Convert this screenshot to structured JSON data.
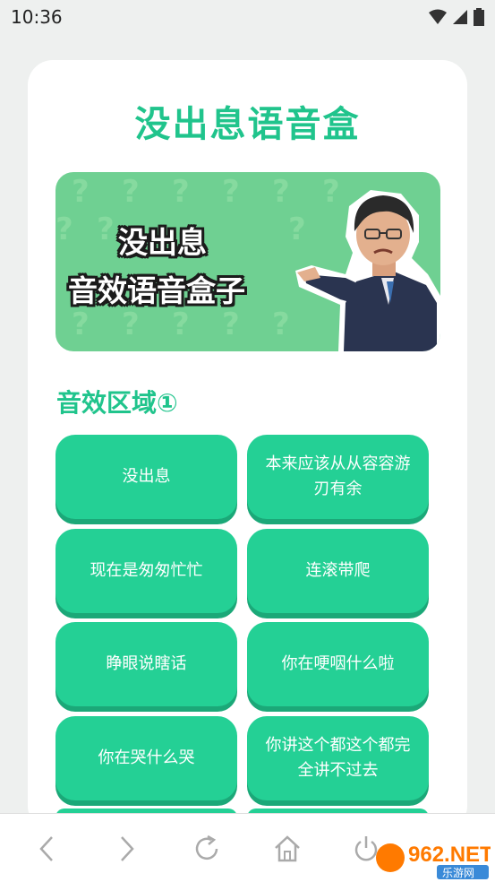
{
  "status_bar": {
    "time": "10:36"
  },
  "app": {
    "title": "没出息语音盒"
  },
  "banner": {
    "line1": "没出息",
    "line2": "音效语音盒子"
  },
  "section": {
    "title": "音效区域①"
  },
  "sound_buttons": [
    {
      "label": "没出息"
    },
    {
      "label": "本来应该从从容容游刃有余"
    },
    {
      "label": "现在是匆匆忙忙"
    },
    {
      "label": "连滚带爬"
    },
    {
      "label": "睁眼说瞎话"
    },
    {
      "label": "你在哽咽什么啦"
    },
    {
      "label": "你在哭什么哭"
    },
    {
      "label": "你讲这个都这个都完全讲不过去"
    }
  ],
  "watermark": {
    "brand": "962.NET",
    "sub": "乐游网"
  },
  "colors": {
    "accent": "#20c48c",
    "button": "#24d095",
    "banner": "#6fd092"
  },
  "icons": [
    "wifi-icon",
    "signal-icon",
    "battery-icon",
    "back-icon",
    "forward-icon",
    "refresh-icon",
    "home-icon",
    "power-icon"
  ]
}
